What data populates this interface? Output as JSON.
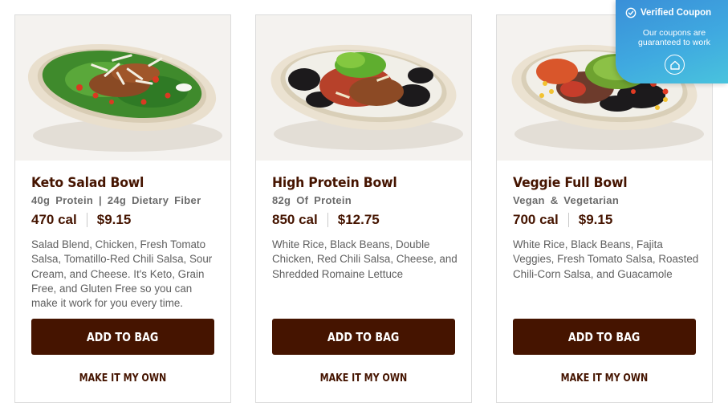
{
  "cards": [
    {
      "title": "Keto Salad Bowl",
      "subtitle": "40g Protein | 24g Dietary Fiber",
      "calories": "470 cal",
      "price": "$9.15",
      "description": "Salad Blend, Chicken, Fresh Tomato Salsa, Tomatillo-Red Chili Salsa, Sour Cream, and Cheese. It's Keto, Grain Free, and Gluten Free so you can make it work for you every time.",
      "add_label": "ADD TO BAG",
      "make_label": "MAKE IT MY OWN"
    },
    {
      "title": "High Protein Bowl",
      "subtitle": "82g Of Protein",
      "calories": "850 cal",
      "price": "$12.75",
      "description": "White Rice, Black Beans, Double Chicken, Red Chili Salsa, Cheese, and Shredded Romaine Lettuce",
      "add_label": "ADD TO BAG",
      "make_label": "MAKE IT MY OWN"
    },
    {
      "title": "Veggie Full Bowl",
      "subtitle": "Vegan & Vegetarian",
      "calories": "700 cal",
      "price": "$9.15",
      "description": "White Rice, Black Beans, Fajita Veggies, Fresh Tomato Salsa, Roasted Chili-Corn Salsa, and Guacamole",
      "add_label": "ADD TO BAG",
      "make_label": "MAKE IT MY OWN"
    }
  ],
  "coupon": {
    "title": "Verified Coupon",
    "text": "Our coupons are guaranteed to work"
  },
  "colors": {
    "brand": "#451400",
    "coupon_blue": "#3fa9e0"
  },
  "icons": [
    "check-circle-icon",
    "coupon-logo-icon"
  ]
}
